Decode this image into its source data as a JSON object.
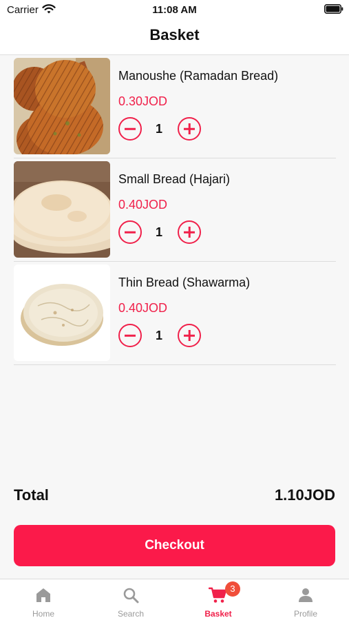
{
  "status_bar": {
    "carrier": "Carrier",
    "time": "11:08 AM"
  },
  "header": {
    "title": "Basket"
  },
  "basket": {
    "items": [
      {
        "name": "Manoushe (Ramadan Bread)",
        "price": "0.30JOD",
        "quantity": "1"
      },
      {
        "name": "Small Bread (Hajari)",
        "price": "0.40JOD",
        "quantity": "1"
      },
      {
        "name": "Thin Bread (Shawarma)",
        "price": "0.40JOD",
        "quantity": "1"
      }
    ]
  },
  "summary": {
    "total_label": "Total",
    "total_value": "1.10JOD"
  },
  "checkout": {
    "label": "Checkout"
  },
  "tabbar": {
    "tabs": [
      {
        "label": "Home",
        "icon": "home-icon"
      },
      {
        "label": "Search",
        "icon": "search-icon"
      },
      {
        "label": "Basket",
        "icon": "cart-icon",
        "badge": "3",
        "active": true
      },
      {
        "label": "Profile",
        "icon": "person-icon"
      }
    ]
  },
  "colors": {
    "accent": "#f0204a",
    "checkout_bg": "#fb1a4a",
    "badge_bg": "#f04e3a"
  }
}
